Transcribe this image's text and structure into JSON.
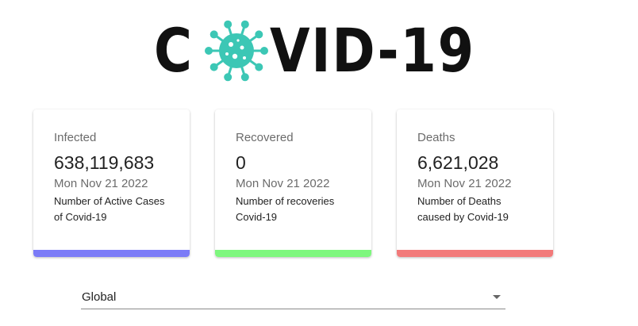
{
  "logo": {
    "text_before": "C",
    "text_after": "VID-19",
    "virus_icon": "virus-icon",
    "virus_color": "#3cc7b5"
  },
  "cards": [
    {
      "title": "Infected",
      "value": "638,119,683",
      "date": "Mon Nov 21 2022",
      "description": "Number of Active Cases of Covid-19",
      "color": "#7b7bf7"
    },
    {
      "title": "Recovered",
      "value": "0",
      "date": "Mon Nov 21 2022",
      "description": "Number of recoveries Covid-19",
      "color": "#7ef77e"
    },
    {
      "title": "Deaths",
      "value": "6,621,028",
      "date": "Mon Nov 21 2022",
      "description": "Number of Deaths caused by Covid-19",
      "color": "#f27a7a"
    }
  ],
  "country_select": {
    "selected": "Global",
    "arrow_icon": "dropdown-arrow-icon"
  }
}
